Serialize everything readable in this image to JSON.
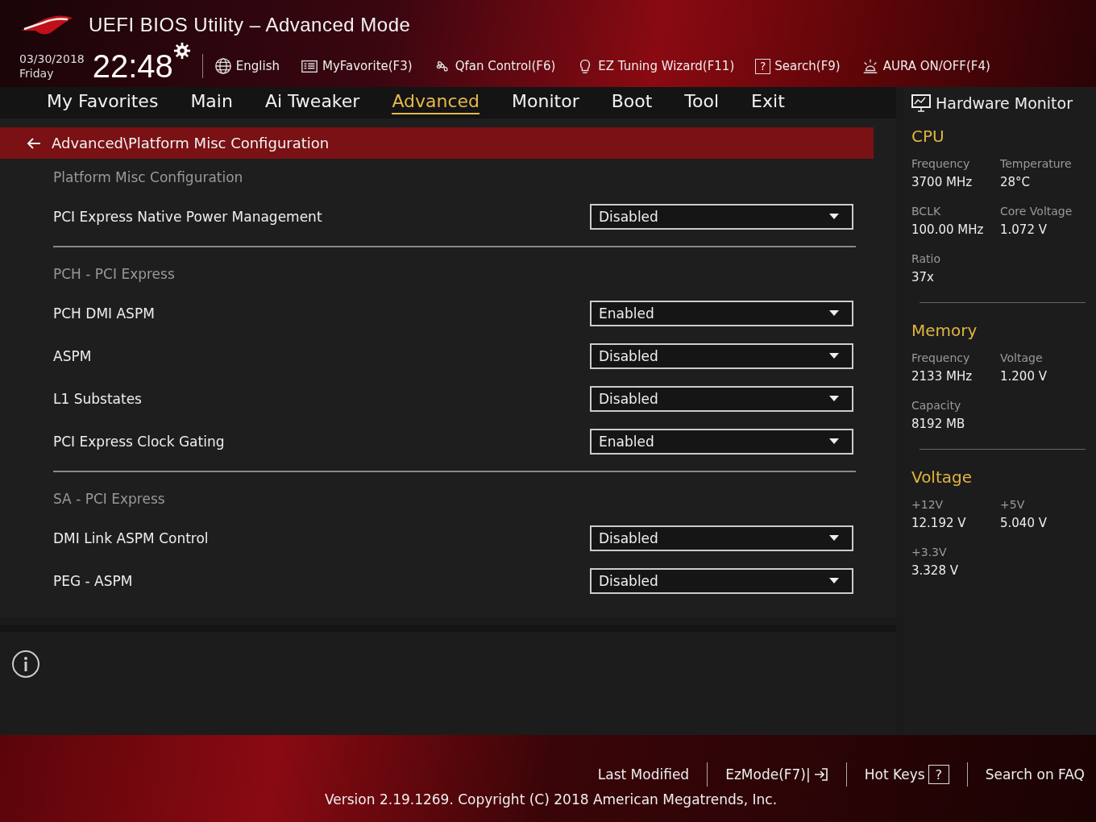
{
  "header": {
    "title": "UEFI BIOS Utility – Advanced Mode",
    "date": "03/30/2018",
    "day": "Friday",
    "time": "22:48",
    "tools": [
      {
        "kind": "globe",
        "label": "English"
      },
      {
        "kind": "list",
        "label": "MyFavorite(F3)"
      },
      {
        "kind": "fan",
        "label": "Qfan Control(F6)"
      },
      {
        "kind": "bulb",
        "label": "EZ Tuning Wizard(F11)"
      },
      {
        "kind": "glyph",
        "glyph": "?",
        "label": "Search(F9)"
      },
      {
        "kind": "aura",
        "label": "AURA ON/OFF(F4)"
      }
    ]
  },
  "tabs": [
    {
      "label": "My Favorites",
      "selected": false
    },
    {
      "label": "Main",
      "selected": false
    },
    {
      "label": "Ai Tweaker",
      "selected": false
    },
    {
      "label": "Advanced",
      "selected": true
    },
    {
      "label": "Monitor",
      "selected": false
    },
    {
      "label": "Boot",
      "selected": false
    },
    {
      "label": "Tool",
      "selected": false
    },
    {
      "label": "Exit",
      "selected": false
    }
  ],
  "breadcrumb": "Advanced\\Platform Misc Configuration",
  "items": [
    {
      "kind": "section",
      "label": "Platform Misc Configuration"
    },
    {
      "kind": "setting",
      "label": "PCI Express Native Power Management",
      "value": "Disabled"
    },
    {
      "kind": "divider"
    },
    {
      "kind": "section",
      "label": "PCH - PCI Express"
    },
    {
      "kind": "setting",
      "label": "PCH DMI ASPM",
      "value": "Enabled"
    },
    {
      "kind": "setting",
      "label": "ASPM",
      "value": "Disabled"
    },
    {
      "kind": "setting",
      "label": "L1 Substates",
      "value": "Disabled"
    },
    {
      "kind": "setting",
      "label": "PCI Express Clock Gating",
      "value": "Enabled"
    },
    {
      "kind": "divider"
    },
    {
      "kind": "section",
      "label": "SA - PCI Express"
    },
    {
      "kind": "setting",
      "label": "DMI Link ASPM Control",
      "value": "Disabled"
    },
    {
      "kind": "setting",
      "label": "PEG - ASPM",
      "value": "Disabled"
    }
  ],
  "hardware_monitor": {
    "title": "Hardware Monitor",
    "sections": [
      {
        "title": "CPU",
        "readings": [
          {
            "label": "Frequency",
            "value": "3700 MHz"
          },
          {
            "label": "Temperature",
            "value": "28°C"
          },
          {
            "label": "BCLK",
            "value": "100.00 MHz"
          },
          {
            "label": "Core Voltage",
            "value": "1.072 V"
          },
          {
            "label": "Ratio",
            "value": "37x"
          }
        ]
      },
      {
        "title": "Memory",
        "readings": [
          {
            "label": "Frequency",
            "value": "2133 MHz"
          },
          {
            "label": "Voltage",
            "value": "1.200 V"
          },
          {
            "label": "Capacity",
            "value": "8192 MB"
          }
        ]
      },
      {
        "title": "Voltage",
        "readings": [
          {
            "label": "+12V",
            "value": "12.192 V"
          },
          {
            "label": "+5V",
            "value": "5.040 V"
          },
          {
            "label": "+3.3V",
            "value": "3.328 V"
          }
        ]
      }
    ]
  },
  "footer": {
    "links": [
      {
        "kind": "text",
        "label": "Last Modified"
      },
      {
        "kind": "exit",
        "label": "EzMode(F7)|"
      },
      {
        "kind": "glyph",
        "label": "Hot Keys",
        "glyph": "?"
      },
      {
        "kind": "text",
        "label": "Search on FAQ"
      }
    ],
    "version": "Version 2.19.1269. Copyright (C) 2018 American Megatrends, Inc."
  }
}
